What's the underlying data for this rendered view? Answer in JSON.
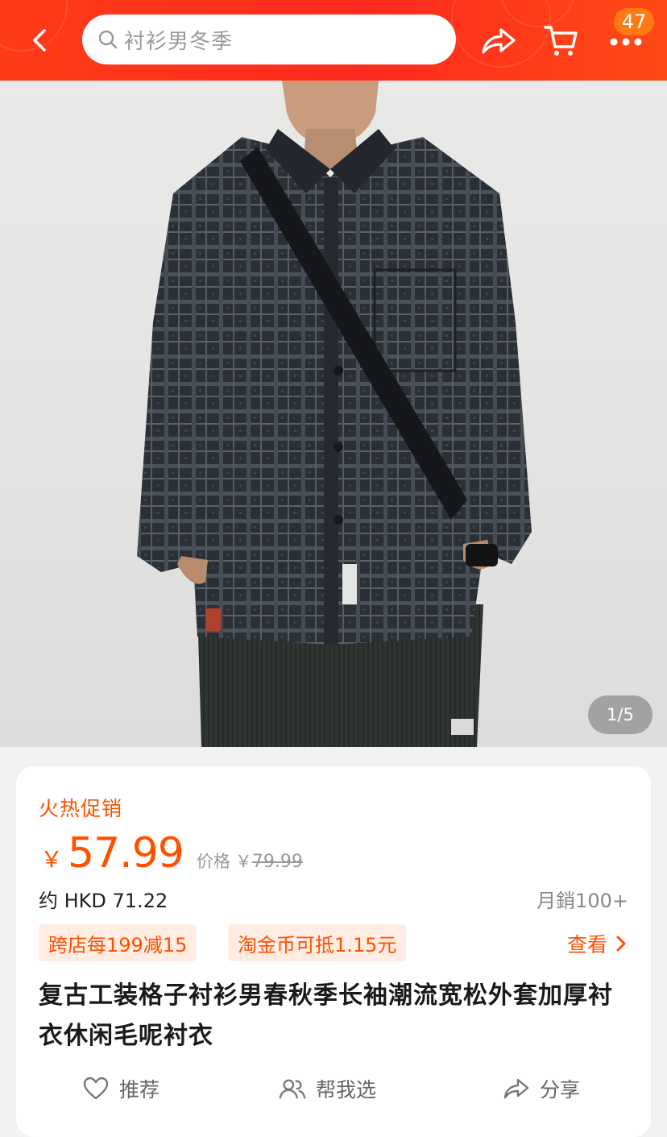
{
  "header": {
    "search_placeholder": "衬衫男冬季",
    "cart_badge": "47",
    "icons": [
      "back-icon",
      "search-icon",
      "share-icon",
      "cart-icon",
      "more-icon"
    ]
  },
  "gallery": {
    "counter": "1/5"
  },
  "product": {
    "promo_label": "火热促销",
    "currency": "￥",
    "price": "57.99",
    "original_label": "价格",
    "original_currency": "￥",
    "original_price": "79.99",
    "hkd_price": "约 HKD 71.22",
    "monthly_sales": "月銷100+",
    "tags": [
      "跨店每199减15",
      "淘金币可抵1.15元"
    ],
    "view_more": "查看",
    "title": "复古工装格子衬衫男春秋季长袖潮流宽松外套加厚衬衣休闲毛呢衬衣"
  },
  "actions": [
    {
      "label": "推荐",
      "icon": "heart-icon"
    },
    {
      "label": "帮我选",
      "icon": "people-icon"
    },
    {
      "label": "分享",
      "icon": "share-icon"
    }
  ],
  "colors": {
    "brand_red": "#ff2a1f",
    "accent_orange": "#ff5000",
    "badge_orange": "#ff7a14"
  }
}
